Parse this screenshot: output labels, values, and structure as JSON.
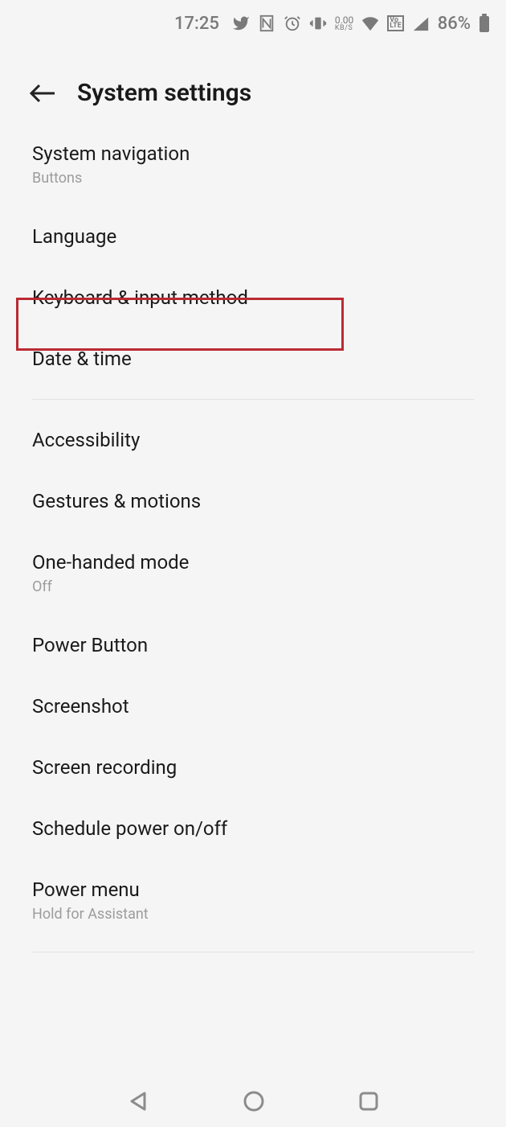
{
  "status": {
    "time": "17:25",
    "speed_value": "0.00",
    "speed_unit": "KB/S",
    "volte": "Vo\nLTE",
    "battery_pct": "86%"
  },
  "header": {
    "title": "System settings"
  },
  "items": {
    "system_nav": {
      "label": "System navigation",
      "sub": "Buttons"
    },
    "language": {
      "label": "Language"
    },
    "keyboard": {
      "label": "Keyboard & input method"
    },
    "date_time": {
      "label": "Date & time"
    },
    "accessibility": {
      "label": "Accessibility"
    },
    "gestures": {
      "label": "Gestures & motions"
    },
    "one_handed": {
      "label": "One-handed mode",
      "sub": "Off"
    },
    "power_button": {
      "label": "Power Button"
    },
    "screenshot": {
      "label": "Screenshot"
    },
    "screen_recording": {
      "label": "Screen recording"
    },
    "schedule_power": {
      "label": "Schedule power on/off"
    },
    "power_menu": {
      "label": "Power menu",
      "sub": "Hold for Assistant"
    }
  }
}
